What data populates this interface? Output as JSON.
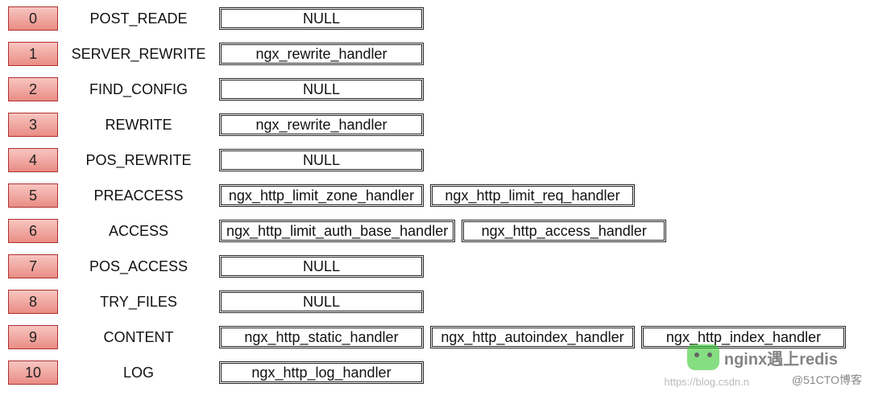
{
  "phases": [
    {
      "index": "0",
      "name": "POST_READE",
      "handlers": [
        "NULL"
      ]
    },
    {
      "index": "1",
      "name": "SERVER_REWRITE",
      "handlers": [
        "ngx_rewrite_handler"
      ]
    },
    {
      "index": "2",
      "name": "FIND_CONFIG",
      "handlers": [
        "NULL"
      ]
    },
    {
      "index": "3",
      "name": "REWRITE",
      "handlers": [
        "ngx_rewrite_handler"
      ]
    },
    {
      "index": "4",
      "name": "POS_REWRITE",
      "handlers": [
        "NULL"
      ]
    },
    {
      "index": "5",
      "name": "PREACCESS",
      "handlers": [
        "ngx_http_limit_zone_handler",
        "ngx_http_limit_req_handler"
      ]
    },
    {
      "index": "6",
      "name": "ACCESS",
      "handlers": [
        "ngx_http_limit_auth_base_handler",
        "ngx_http_access_handler"
      ]
    },
    {
      "index": "7",
      "name": "POS_ACCESS",
      "handlers": [
        "NULL"
      ]
    },
    {
      "index": "8",
      "name": "TRY_FILES",
      "handlers": [
        "NULL"
      ]
    },
    {
      "index": "9",
      "name": "CONTENT",
      "handlers": [
        "ngx_http_static_handler",
        "ngx_http_autoindex_handler",
        "ngx_http_index_handler"
      ]
    },
    {
      "index": "10",
      "name": "LOG",
      "handlers": [
        "ngx_http_log_handler"
      ]
    }
  ],
  "watermark": {
    "logo_text": "nginx遇上redis",
    "url": "https://blog.csdn.n",
    "blog": "@51CTO博客"
  }
}
